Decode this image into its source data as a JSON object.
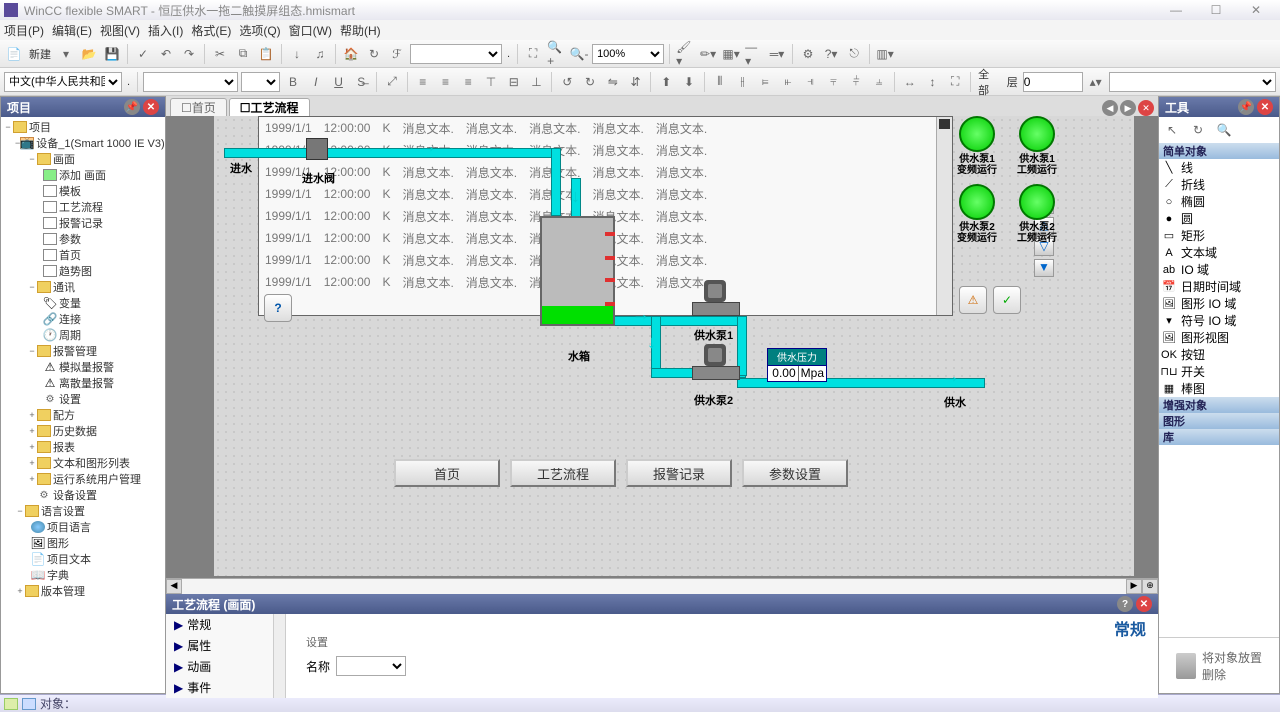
{
  "titlebar": {
    "app": "WinCC flexible SMART",
    "file": "恒压供水一拖二触摸屏组态.hmismart"
  },
  "menu": [
    "项目(P)",
    "编辑(E)",
    "视图(V)",
    "插入(I)",
    "格式(E)",
    "选项(Q)",
    "窗口(W)",
    "帮助(H)"
  ],
  "toolbar": {
    "new_label": "新建",
    "zoom": "100%",
    "lang": "中文(中华人民共和国)",
    "layer_full": "全部",
    "layer_lbl": "层",
    "layer_no": "0"
  },
  "panels": {
    "project": "项目",
    "tools": "工具",
    "props_title": "工艺流程 (画面)"
  },
  "tree": {
    "root": "项目",
    "device": "设备_1(Smart 1000 IE V3)",
    "screens_folder": "画面",
    "screens": [
      "添加 画面",
      "模板",
      "工艺流程",
      "报警记录",
      "参数",
      "首页",
      "趋势图"
    ],
    "comm_folder": "通讯",
    "comm": [
      "变量",
      "连接",
      "周期"
    ],
    "alarm_folder": "报警管理",
    "alarm": [
      "模拟量报警",
      "离散量报警",
      "设置"
    ],
    "recipe": "配方",
    "history": "历史数据",
    "report": "报表",
    "textlist": "文本和图形列表",
    "useradmin": "运行系统用户管理",
    "devset": "设备设置",
    "lang_folder": "语言设置",
    "lang": [
      "项目语言",
      "图形",
      "项目文本",
      "字典"
    ],
    "version": "版本管理"
  },
  "tabs": {
    "home": "首页",
    "process": "工艺流程"
  },
  "alarm": {
    "date": "1999/1/1",
    "time": "12:00:00",
    "flag": "K",
    "msg": "消息文本."
  },
  "hmi": {
    "inlet": "进水",
    "inlet_valve": "进水阀",
    "tank": "水箱",
    "pump1": "供水泵1",
    "pump2": "供水泵2",
    "supply": "供水",
    "pressure_hdr": "供水压力",
    "pressure_val": "0.00",
    "pressure_unit": "Mpa",
    "lamp1a": "供水泵1\n变频运行",
    "lamp1b": "供水泵1\n工频运行",
    "lamp2a": "供水泵2\n变频运行",
    "lamp2b": "供水泵2\n工频运行",
    "nav": [
      "首页",
      "工艺流程",
      "报警记录",
      "参数设置"
    ]
  },
  "props": {
    "tabs": [
      "常规",
      "属性",
      "动画",
      "事件"
    ],
    "heading": "常规",
    "group": "设置",
    "name_lbl": "名称"
  },
  "tools": {
    "cat_simple": "简单对象",
    "items": [
      {
        "ico": "╲",
        "label": "线"
      },
      {
        "ico": "⟋",
        "label": "折线"
      },
      {
        "ico": "○",
        "label": "椭圆"
      },
      {
        "ico": "●",
        "label": "圆"
      },
      {
        "ico": "▭",
        "label": "矩形"
      },
      {
        "ico": "A",
        "label": "文本域"
      },
      {
        "ico": "ab",
        "label": "IO 域"
      },
      {
        "ico": "📅",
        "label": "日期时间域"
      },
      {
        "ico": "🖼",
        "label": "图形 IO 域"
      },
      {
        "ico": "▾",
        "label": "符号 IO 域"
      },
      {
        "ico": "🖼",
        "label": "图形视图"
      },
      {
        "ico": "OK",
        "label": "按钮"
      },
      {
        "ico": "⊓⊔",
        "label": "开关"
      },
      {
        "ico": "▦",
        "label": "棒图"
      }
    ],
    "cat_adv": "增强对象",
    "cat_gfx": "图形",
    "cat_lib": "库",
    "delete": "将对象放置\n删除"
  },
  "status": {
    "obj_lbl": "对象："
  }
}
